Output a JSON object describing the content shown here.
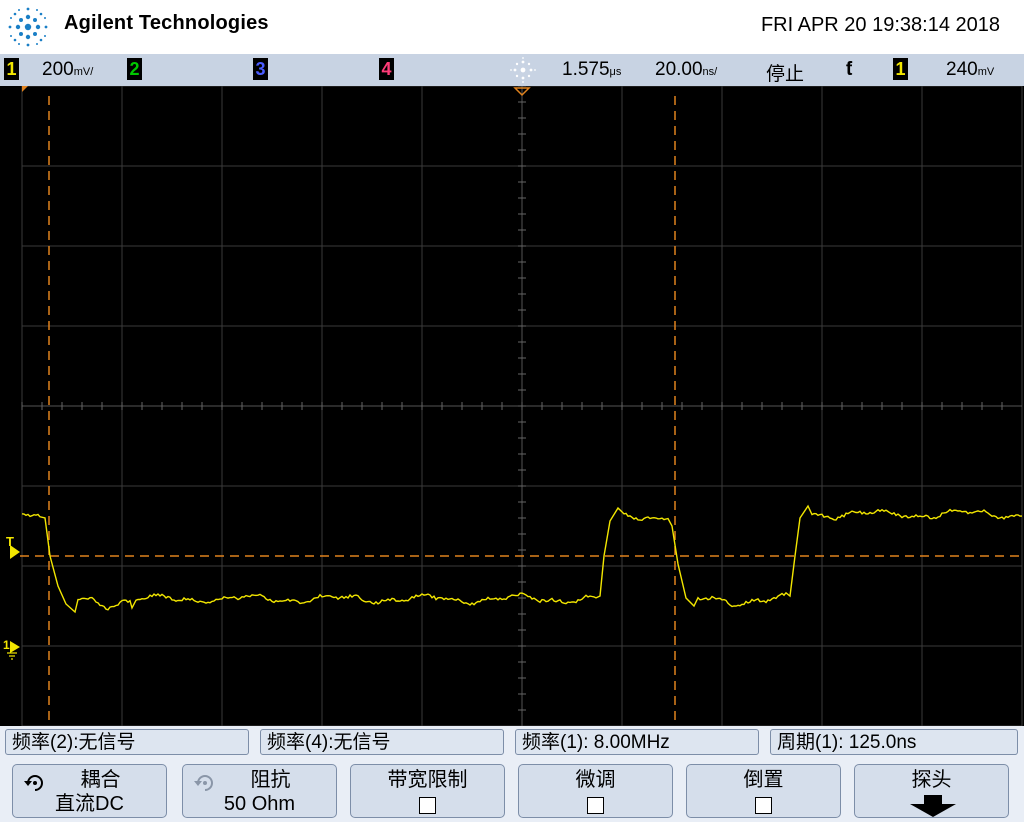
{
  "header": {
    "brand": "Agilent Technologies",
    "datetime": "FRI APR 20 19:38:14 2018"
  },
  "status": {
    "ch1_label": "1",
    "ch1_scale": "200",
    "ch1_scale_unit": "mV/",
    "ch2_label": "2",
    "ch3_label": "3",
    "ch4_label": "4",
    "trigger_delay": "1.575",
    "trigger_delay_unit": "μs",
    "timebase": "20.00",
    "timebase_unit": "ns/",
    "run_state": "停止",
    "trigger_edge_symbol": "ƭ",
    "trigger_source": "1",
    "trigger_level": "240",
    "trigger_level_unit": "mV",
    "colors": {
      "ch1": "#f2e600",
      "ch2": "#00c800",
      "ch3": "#4a5cff",
      "ch4": "#ff3c78",
      "cursor": "#e0821e"
    }
  },
  "screen": {
    "trig_marker_label": "T",
    "ground_marker_label": "1"
  },
  "measurements": [
    {
      "label": "频率(2):无信号"
    },
    {
      "label": "频率(4):无信号"
    },
    {
      "label": "频率(1): 8.00MHz"
    },
    {
      "label": "周期(1): 125.0ns"
    }
  ],
  "softkeys": {
    "coupling": {
      "line1": "耦合",
      "line2": "直流DC",
      "icon": "rotate-knob-icon"
    },
    "impedance": {
      "line1": "阻抗",
      "line2": "50 Ohm",
      "icon": "rotate-knob-icon"
    },
    "bw_limit": {
      "line1": "带宽限制",
      "checked": false
    },
    "fine": {
      "line1": "微调",
      "checked": false
    },
    "invert": {
      "line1": "倒置",
      "checked": false
    },
    "probe": {
      "line1": "探头",
      "icon": "arrow-down-icon"
    }
  }
}
